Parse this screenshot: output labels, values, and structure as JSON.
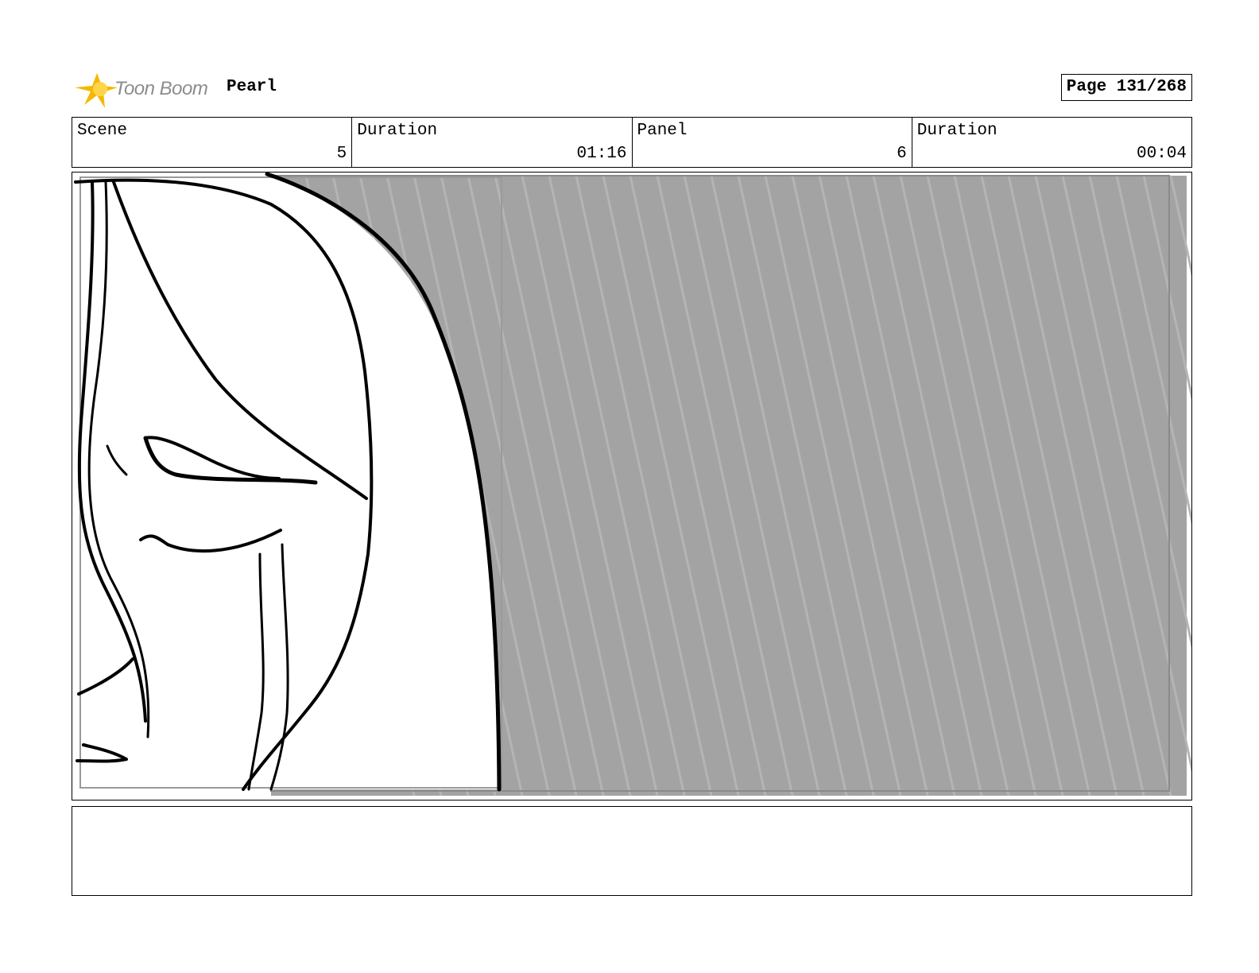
{
  "header": {
    "logo_text": "Toon Boom",
    "project_title": "Pearl",
    "page_label": "Page 131/268"
  },
  "info": {
    "scene_label": "Scene",
    "scene_value": "5",
    "scene_duration_label": "Duration",
    "scene_duration_value": "01:16",
    "panel_label": "Panel",
    "panel_value": "6",
    "panel_duration_label": "Duration",
    "panel_duration_value": "00:04"
  },
  "colors": {
    "logo_yellow": "#f5b800",
    "background_gray": "#a3a3a3",
    "streak_gray": "#b4b4b4"
  },
  "notes": {
    "text": ""
  }
}
